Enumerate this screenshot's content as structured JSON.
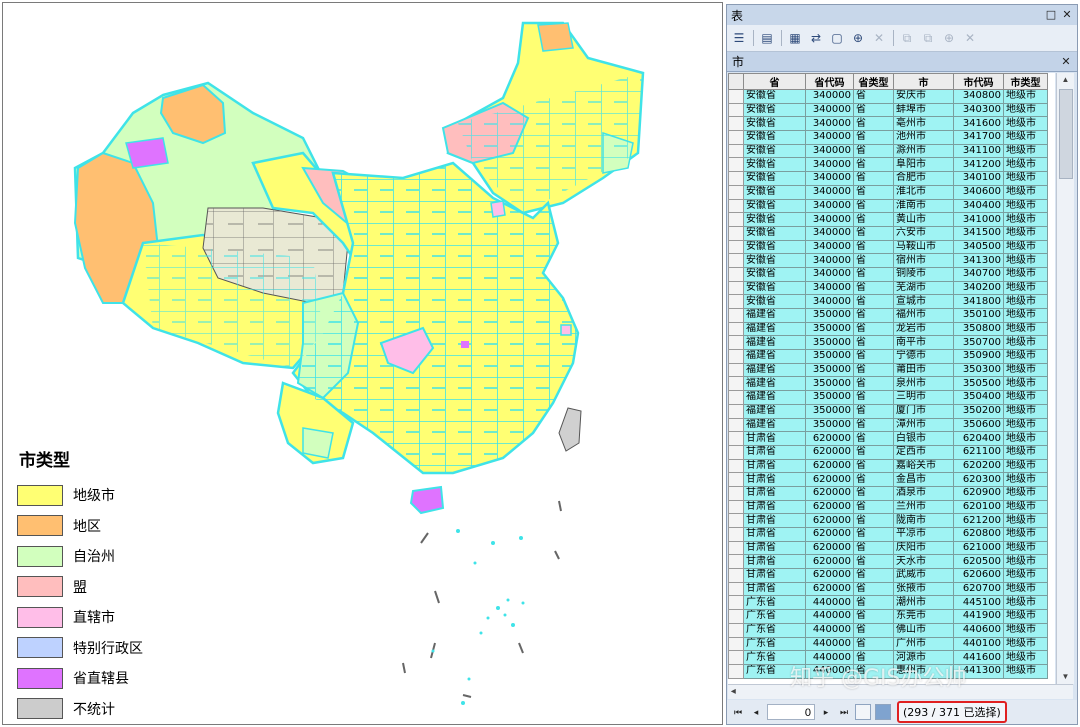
{
  "legend": {
    "title": "市类型",
    "items": [
      {
        "label": "地级市",
        "color": "#ffff73"
      },
      {
        "label": "地区",
        "color": "#ffbf71"
      },
      {
        "label": "自治州",
        "color": "#d2ffbe"
      },
      {
        "label": "盟",
        "color": "#ffbebe"
      },
      {
        "label": "直辖市",
        "color": "#ffbee8"
      },
      {
        "label": "特别行政区",
        "color": "#bed2ff"
      },
      {
        "label": "省直辖县",
        "color": "#df73ff"
      },
      {
        "label": "不统计",
        "color": "#cccccc"
      }
    ]
  },
  "map_colors": {
    "outline": "#3fe3e8",
    "uncounted": "#d0d0d0",
    "dark_line": "#555555"
  },
  "table_window": {
    "title": "表",
    "tab": "市",
    "columns": [
      "省",
      "省代码",
      "省类型",
      "市",
      "市代码",
      "市类型"
    ],
    "rows": [
      [
        "安徽省",
        "340000",
        "省",
        "安庆市",
        "340800",
        "地级市"
      ],
      [
        "安徽省",
        "340000",
        "省",
        "蚌埠市",
        "340300",
        "地级市"
      ],
      [
        "安徽省",
        "340000",
        "省",
        "亳州市",
        "341600",
        "地级市"
      ],
      [
        "安徽省",
        "340000",
        "省",
        "池州市",
        "341700",
        "地级市"
      ],
      [
        "安徽省",
        "340000",
        "省",
        "滁州市",
        "341100",
        "地级市"
      ],
      [
        "安徽省",
        "340000",
        "省",
        "阜阳市",
        "341200",
        "地级市"
      ],
      [
        "安徽省",
        "340000",
        "省",
        "合肥市",
        "340100",
        "地级市"
      ],
      [
        "安徽省",
        "340000",
        "省",
        "淮北市",
        "340600",
        "地级市"
      ],
      [
        "安徽省",
        "340000",
        "省",
        "淮南市",
        "340400",
        "地级市"
      ],
      [
        "安徽省",
        "340000",
        "省",
        "黄山市",
        "341000",
        "地级市"
      ],
      [
        "安徽省",
        "340000",
        "省",
        "六安市",
        "341500",
        "地级市"
      ],
      [
        "安徽省",
        "340000",
        "省",
        "马鞍山市",
        "340500",
        "地级市"
      ],
      [
        "安徽省",
        "340000",
        "省",
        "宿州市",
        "341300",
        "地级市"
      ],
      [
        "安徽省",
        "340000",
        "省",
        "铜陵市",
        "340700",
        "地级市"
      ],
      [
        "安徽省",
        "340000",
        "省",
        "芜湖市",
        "340200",
        "地级市"
      ],
      [
        "安徽省",
        "340000",
        "省",
        "宣城市",
        "341800",
        "地级市"
      ],
      [
        "福建省",
        "350000",
        "省",
        "福州市",
        "350100",
        "地级市"
      ],
      [
        "福建省",
        "350000",
        "省",
        "龙岩市",
        "350800",
        "地级市"
      ],
      [
        "福建省",
        "350000",
        "省",
        "南平市",
        "350700",
        "地级市"
      ],
      [
        "福建省",
        "350000",
        "省",
        "宁德市",
        "350900",
        "地级市"
      ],
      [
        "福建省",
        "350000",
        "省",
        "莆田市",
        "350300",
        "地级市"
      ],
      [
        "福建省",
        "350000",
        "省",
        "泉州市",
        "350500",
        "地级市"
      ],
      [
        "福建省",
        "350000",
        "省",
        "三明市",
        "350400",
        "地级市"
      ],
      [
        "福建省",
        "350000",
        "省",
        "厦门市",
        "350200",
        "地级市"
      ],
      [
        "福建省",
        "350000",
        "省",
        "漳州市",
        "350600",
        "地级市"
      ],
      [
        "甘肃省",
        "620000",
        "省",
        "白银市",
        "620400",
        "地级市"
      ],
      [
        "甘肃省",
        "620000",
        "省",
        "定西市",
        "621100",
        "地级市"
      ],
      [
        "甘肃省",
        "620000",
        "省",
        "嘉峪关市",
        "620200",
        "地级市"
      ],
      [
        "甘肃省",
        "620000",
        "省",
        "金昌市",
        "620300",
        "地级市"
      ],
      [
        "甘肃省",
        "620000",
        "省",
        "酒泉市",
        "620900",
        "地级市"
      ],
      [
        "甘肃省",
        "620000",
        "省",
        "兰州市",
        "620100",
        "地级市"
      ],
      [
        "甘肃省",
        "620000",
        "省",
        "陇南市",
        "621200",
        "地级市"
      ],
      [
        "甘肃省",
        "620000",
        "省",
        "平凉市",
        "620800",
        "地级市"
      ],
      [
        "甘肃省",
        "620000",
        "省",
        "庆阳市",
        "621000",
        "地级市"
      ],
      [
        "甘肃省",
        "620000",
        "省",
        "天水市",
        "620500",
        "地级市"
      ],
      [
        "甘肃省",
        "620000",
        "省",
        "武威市",
        "620600",
        "地级市"
      ],
      [
        "甘肃省",
        "620000",
        "省",
        "张掖市",
        "620700",
        "地级市"
      ],
      [
        "广东省",
        "440000",
        "省",
        "潮州市",
        "445100",
        "地级市"
      ],
      [
        "广东省",
        "440000",
        "省",
        "东莞市",
        "441900",
        "地级市"
      ],
      [
        "广东省",
        "440000",
        "省",
        "佛山市",
        "440600",
        "地级市"
      ],
      [
        "广东省",
        "440000",
        "省",
        "广州市",
        "440100",
        "地级市"
      ],
      [
        "广东省",
        "440000",
        "省",
        "河源市",
        "441600",
        "地级市"
      ],
      [
        "广东省",
        "440000",
        "省",
        "惠州市",
        "441300",
        "地级市"
      ]
    ],
    "record_index": "0",
    "selection_text": "(293 / 371 已选择)"
  },
  "watermark": "知乎 @GIS办公帅"
}
